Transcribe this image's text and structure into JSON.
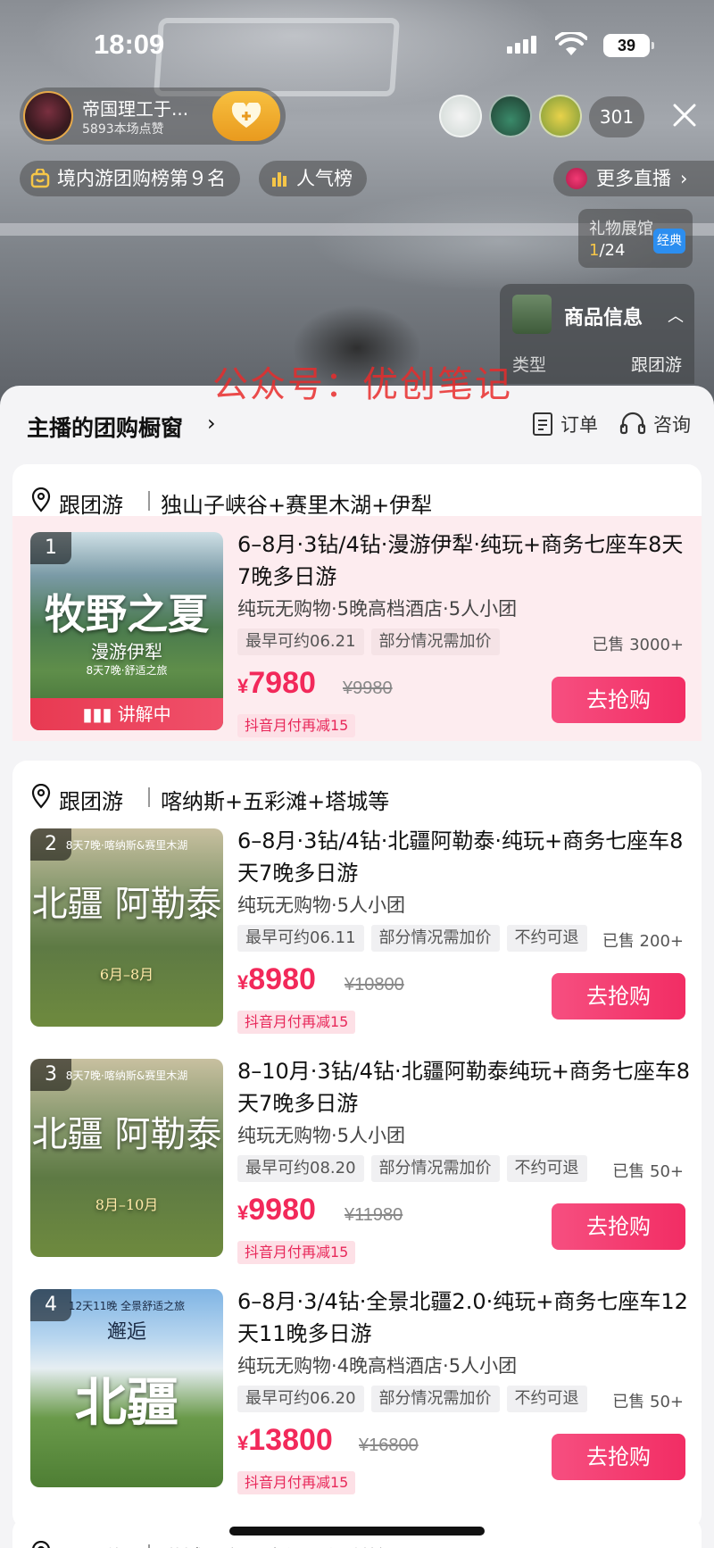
{
  "status_bar": {
    "time": "18:09",
    "battery": "39"
  },
  "live": {
    "host_name": "帝国理工于...",
    "host_likes": "5893本场点赞",
    "viewer_count": "301",
    "rank_chip": "境内游团购榜第９名",
    "popularity_chip": "人气榜",
    "more_live": "更多直播",
    "gift_hall_title": "礼物展馆",
    "gift_hall_current": "1",
    "gift_hall_total": "/24",
    "gift_hall_badge": "经典",
    "product_info_title": "商品信息",
    "product_info_type_label": "类型",
    "product_info_type_value": "跟团游"
  },
  "watermark": "公众号：优创笔记",
  "sheet": {
    "title": "主播的团购橱窗",
    "orders_label": "订单",
    "consult_label": "咨询"
  },
  "groups": [
    {
      "type": "跟团游",
      "route": "独山子峡谷+赛里木湖+伊犁",
      "items": [
        {
          "rank": "1",
          "title": "6–8月·3钻/4钻·漫游伊犁·纯玩+商务七座车8天7晚多日游",
          "subtitle": "纯玩无购物·5晚高档酒店·5人小团",
          "tags": [
            "最早可约06.21",
            "部分情况需加价"
          ],
          "sold": "已售 3000+",
          "price_symbol": "¥",
          "price": "7980",
          "original_price": "¥9980",
          "coupon": "抖音月付再减15",
          "buy": "去抢购",
          "thumb_big": "牧野之夏",
          "thumb_sub": "漫游伊犁",
          "thumb_small": "8天7晚·舒适之旅",
          "thumb_bar": "讲解中"
        }
      ]
    },
    {
      "type": "跟团游",
      "route": "喀纳斯+五彩滩+塔城等",
      "items": [
        {
          "rank": "2",
          "title": "6–8月·3钻/4钻·北疆阿勒泰·纯玩+商务七座车8天7晚多日游",
          "subtitle": "纯玩无购物·5人小团",
          "tags": [
            "最早可约06.11",
            "部分情况需加价",
            "不约可退"
          ],
          "sold": "已售 200+",
          "price_symbol": "¥",
          "price": "8980",
          "original_price": "¥10800",
          "coupon": "抖音月付再减15",
          "buy": "去抢购",
          "thumb_big": "北疆 阿勒泰",
          "thumb_sub": "6月–8月",
          "thumb_small": "8天7晚·喀纳斯&赛里木湖"
        },
        {
          "rank": "3",
          "title": "8–10月·3钻/4钻·北疆阿勒泰纯玩+商务七座车8天7晚多日游",
          "subtitle": "纯玩无购物·5人小团",
          "tags": [
            "最早可约08.20",
            "部分情况需加价",
            "不约可退"
          ],
          "sold": "已售 50+",
          "price_symbol": "¥",
          "price": "9980",
          "original_price": "¥11980",
          "coupon": "抖音月付再减15",
          "buy": "去抢购",
          "thumb_big": "北疆 阿勒泰",
          "thumb_sub": "8月–10月",
          "thumb_small": "8天7晚·喀纳斯&赛里木湖"
        },
        {
          "rank": "4",
          "title": "6–8月·3/4钻·全景北疆2.0·纯玩+商务七座车12天11晚多日游",
          "subtitle": "纯玩无购物·4晚高档酒店·5人小团",
          "tags": [
            "最早可约06.20",
            "部分情况需加价",
            "不约可退"
          ],
          "sold": "已售 50+",
          "price_symbol": "¥",
          "price": "13800",
          "original_price": "¥16800",
          "coupon": "抖音月付再减15",
          "buy": "去抢购",
          "thumb_big": "北疆",
          "thumb_sub": "邂逅",
          "thumb_small": "12天11晚 全景舒适之旅"
        }
      ]
    },
    {
      "type": "跟团游",
      "route": "塔城+赛里木湖+伊犁等"
    }
  ],
  "colors": {
    "accent": "#f22d64",
    "price": "#f2295a",
    "highlight_bg": "#fdecef",
    "watermark": "#e82c2c"
  }
}
